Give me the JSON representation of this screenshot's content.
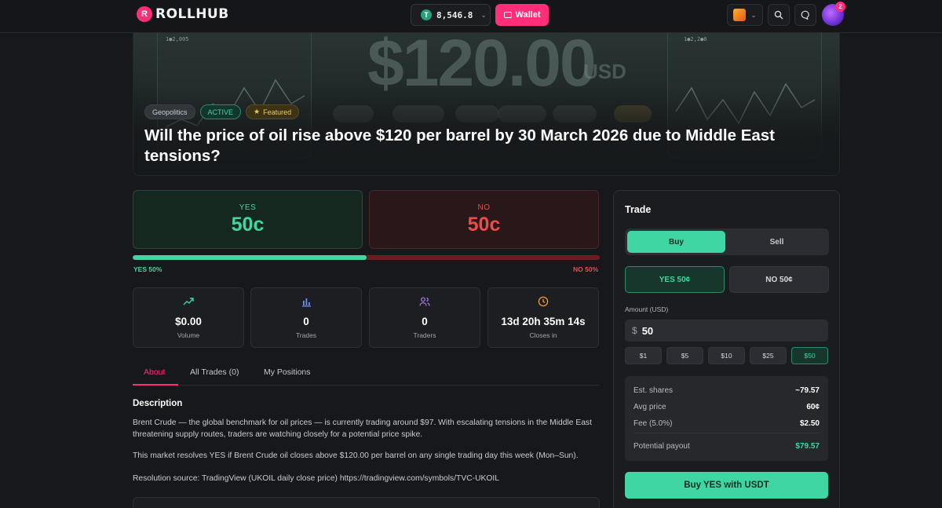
{
  "header": {
    "logo_text": "ROLLHUB",
    "balance": "8,546.8",
    "wallet_label": "Wallet",
    "notification_count": "2"
  },
  "hero": {
    "background_price": "$120.00",
    "background_unit": "USD",
    "tags": [
      "Geopolitics",
      "ACTIVE",
      "Featured"
    ],
    "title": "Will the price of oil rise above $120 per barrel by 30 March 2026 due to Middle East tensions?"
  },
  "outcomes": {
    "yes": {
      "label": "YES",
      "price": "50c"
    },
    "no": {
      "label": "NO",
      "price": "50c"
    },
    "yes_probability": 0.5,
    "yes_bar_label": "YES 50%",
    "no_bar_label": "NO 50%"
  },
  "stats": [
    {
      "icon": "trending-up-icon",
      "value": "$0.00",
      "label": "Volume"
    },
    {
      "icon": "bar-chart-icon",
      "value": "0",
      "label": "Trades"
    },
    {
      "icon": "users-icon",
      "value": "0",
      "label": "Traders"
    },
    {
      "icon": "clock-icon",
      "value": "13d 20h 35m 14s",
      "label": "Closes in"
    }
  ],
  "tabs": [
    "About",
    "All Trades (0)",
    "My Positions"
  ],
  "description": {
    "heading": "Description",
    "paragraphs": [
      "Brent Crude — the global benchmark for oil prices — is currently trading around $97. With escalating tensions in the Middle East threatening supply routes, traders are watching closely for a potential price spike.",
      "This market resolves YES if Brent Crude oil closes above $120.00 per barrel on any single trading day this week (Mon–Sun).",
      "Resolution source: TradingView (UKOIL daily close price) https://tradingview.com/symbols/TVC-UKOIL"
    ]
  },
  "trade": {
    "title": "Trade",
    "buy_label": "Buy",
    "sell_label": "Sell",
    "yes_option": "YES 50¢",
    "no_option": "NO 50¢",
    "amount_label": "Amount (USD)",
    "currency_symbol": "$",
    "amount_value": "50",
    "quick_amounts": [
      "$1",
      "$5",
      "$10",
      "$25",
      "$50"
    ],
    "summary": {
      "est_shares_label": "Est. shares",
      "est_shares": "~79.57",
      "avg_price_label": "Avg price",
      "avg_price": "60¢",
      "fee_label": "Fee (5.0%)",
      "fee": "$2.50",
      "payout_label": "Potential payout",
      "payout": "$79.57"
    },
    "submit_label": "Buy YES with USDT"
  },
  "colors": {
    "accent": "#ff2d7a",
    "yes": "#3fd6a3",
    "no": "#ef4a4a"
  }
}
